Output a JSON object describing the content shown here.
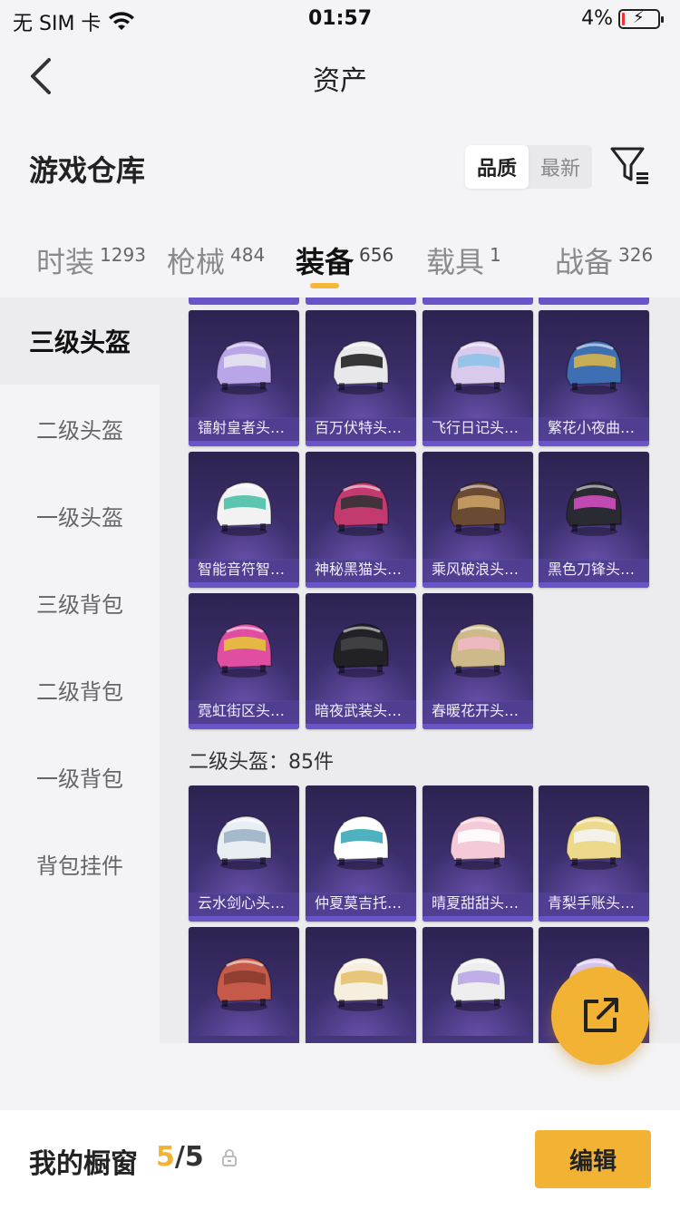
{
  "status": {
    "carrier": "无 SIM 卡",
    "time": "01:57",
    "battery": "4%"
  },
  "nav": {
    "title": "资产"
  },
  "warehouse": {
    "title": "游戏仓库",
    "sort": [
      "品质",
      "最新"
    ]
  },
  "tabs": [
    {
      "label": "时装",
      "count": "1293"
    },
    {
      "label": "枪械",
      "count": "484"
    },
    {
      "label": "装备",
      "count": "656"
    },
    {
      "label": "载具",
      "count": "1"
    },
    {
      "label": "战备",
      "count": "326"
    }
  ],
  "sidebar": [
    "三级头盔",
    "二级头盔",
    "一级头盔",
    "三级背包",
    "二级背包",
    "一级背包",
    "背包挂件"
  ],
  "level3": {
    "items": [
      {
        "name": "镭射皇者头…",
        "color": "#b9a6e8",
        "accent": "#e6e6f0"
      },
      {
        "name": "百万伏特头…",
        "color": "#e8e8ea",
        "accent": "#222222"
      },
      {
        "name": "飞行日记头…",
        "color": "#d9c9ec",
        "accent": "#8ec2e8"
      },
      {
        "name": "繁花小夜曲…",
        "color": "#3e6fb2",
        "accent": "#d6b24b"
      },
      {
        "name": "智能音符智…",
        "color": "#f2f2f2",
        "accent": "#4ac0a8"
      },
      {
        "name": "神秘黑猫头…",
        "color": "#c23a6e",
        "accent": "#333333"
      },
      {
        "name": "乘风破浪头…",
        "color": "#6b4a34",
        "accent": "#c9a064"
      },
      {
        "name": "黑色刀锋头…",
        "color": "#2a2a33",
        "accent": "#d14cc0"
      },
      {
        "name": "霓虹街区头…",
        "color": "#e04ea2",
        "accent": "#e6c338"
      },
      {
        "name": "暗夜武装头…",
        "color": "#222226",
        "accent": "#444448"
      },
      {
        "name": "春暖花开头…",
        "color": "#cdb98a",
        "accent": "#f2b8c6"
      }
    ]
  },
  "level2": {
    "label": "二级头盔：85件",
    "items": [
      {
        "name": "云水剑心头…",
        "color": "#e9eef3",
        "accent": "#9cb3c8"
      },
      {
        "name": "仲夏莫吉托…",
        "color": "#ffffff",
        "accent": "#3aa8b8"
      },
      {
        "name": "晴夏甜甜头…",
        "color": "#f4c9d8",
        "accent": "#ffffff"
      },
      {
        "name": "青梨手账头…",
        "color": "#ecd98c",
        "accent": "#f4f4f4"
      },
      {
        "name": "",
        "color": "#c55a4a",
        "accent": "#8a3a30"
      },
      {
        "name": "",
        "color": "#f6efe0",
        "accent": "#e6c070"
      },
      {
        "name": "",
        "color": "#eeeeee",
        "accent": "#b8a8e6"
      },
      {
        "name": "",
        "color": "#d8c6f0",
        "accent": "#ffffff"
      }
    ]
  },
  "showcase": {
    "label": "我的橱窗",
    "current": "5",
    "total": "/5"
  },
  "edit_label": "编辑"
}
